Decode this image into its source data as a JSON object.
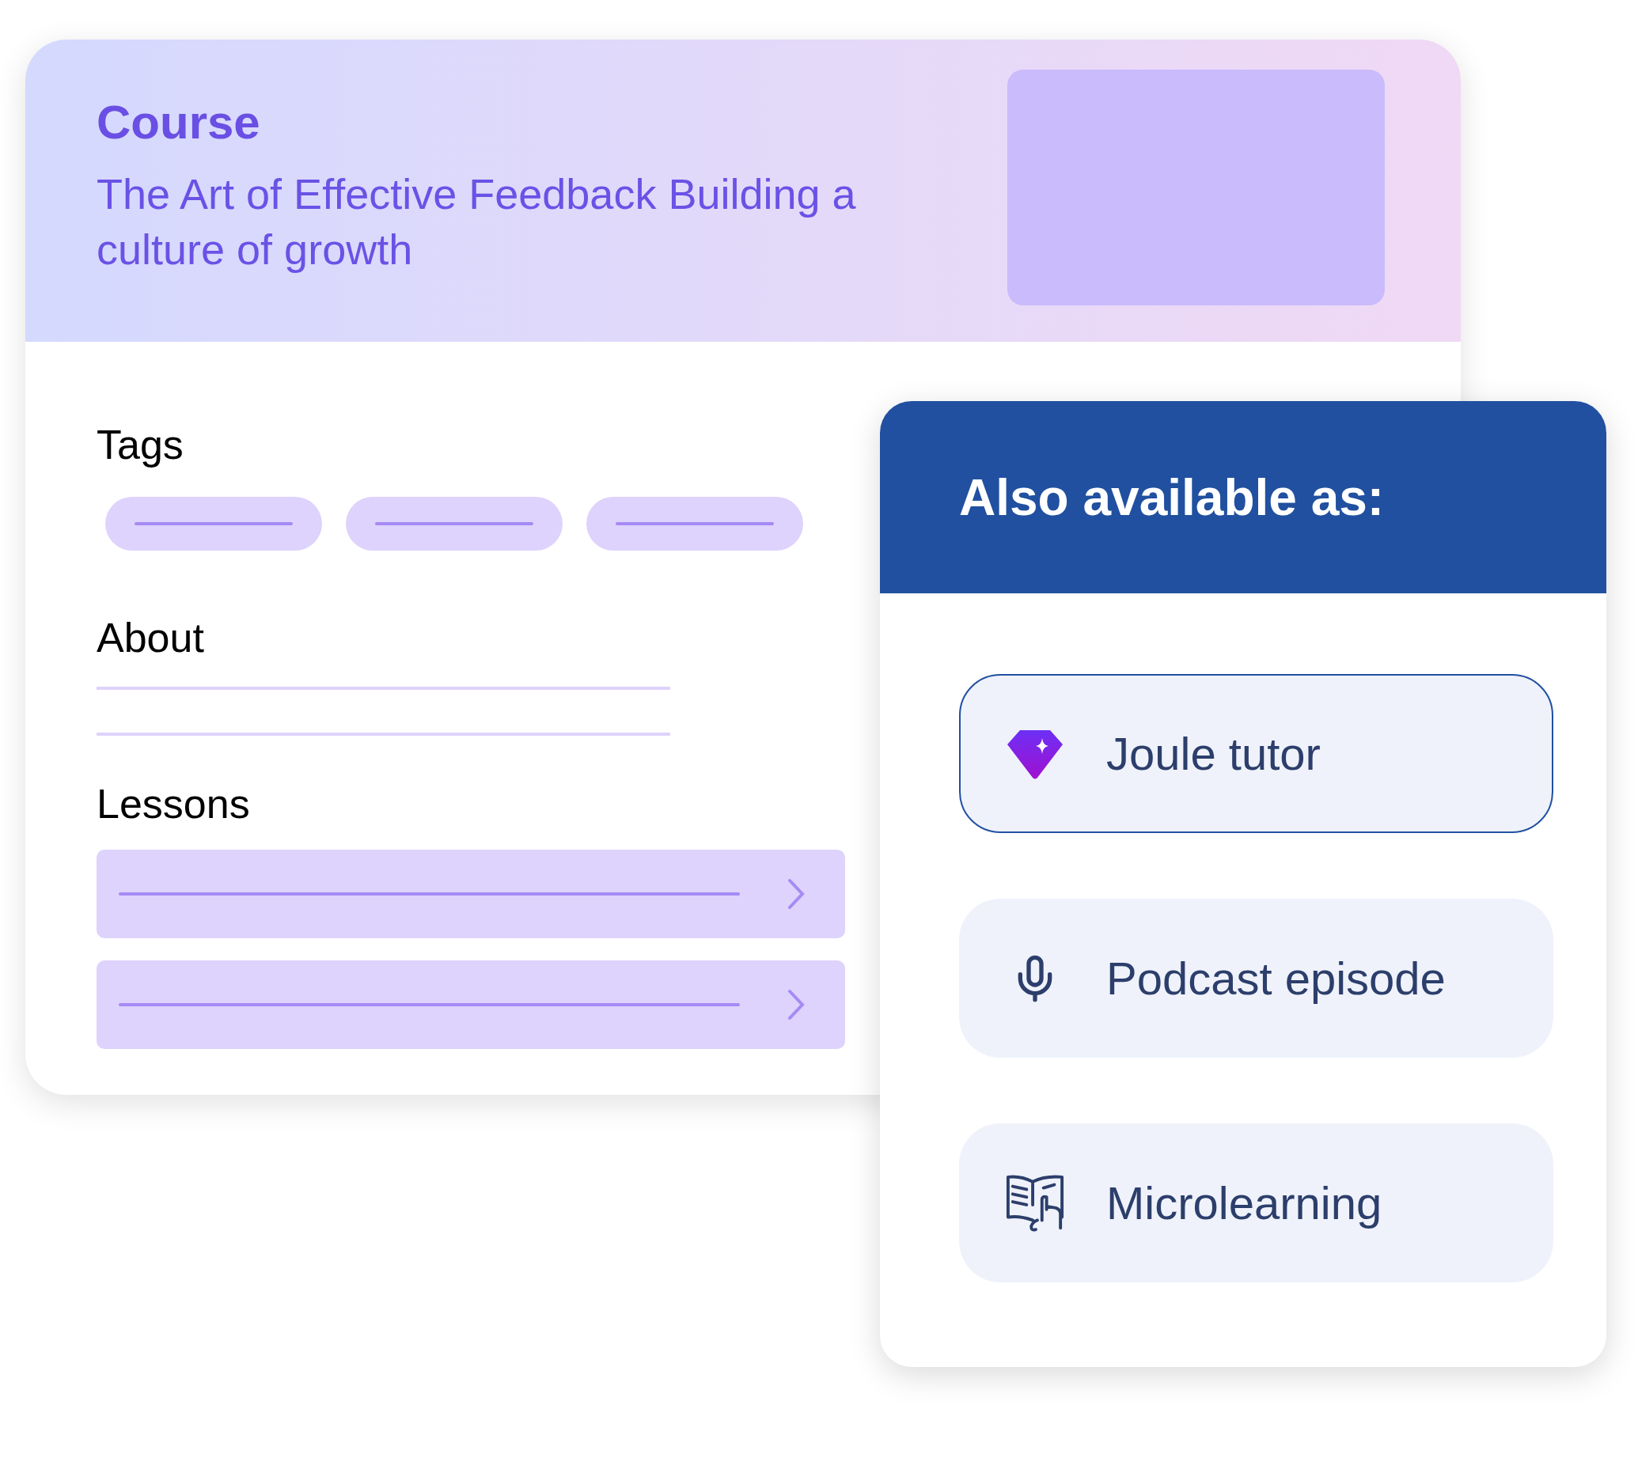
{
  "course_card": {
    "label": "Course",
    "title": "The Art of Effective Feedback Building a culture of growth",
    "sections": [
      {
        "heading": "Tags"
      },
      {
        "heading": "About"
      },
      {
        "heading": "Lessons"
      }
    ]
  },
  "formats_card": {
    "title": "Also available as:",
    "options": [
      {
        "kind": "tutor",
        "label": "Joule tutor",
        "selected": true
      },
      {
        "kind": "podcast",
        "label": "Podcast episode",
        "selected": false
      },
      {
        "kind": "microlearning",
        "label": "Microlearning",
        "selected": false
      }
    ]
  }
}
